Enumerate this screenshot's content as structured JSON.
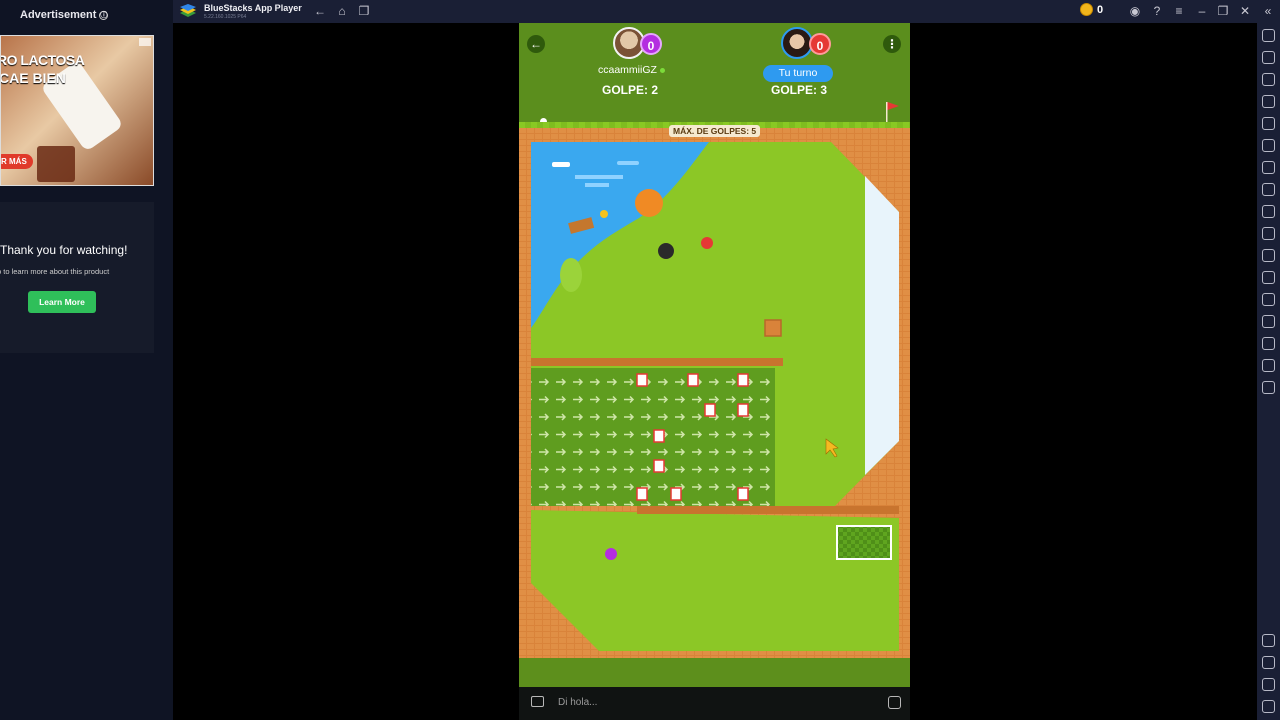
{
  "advertisement": {
    "header": "Advertisement",
    "info_icon": "ⓘ",
    "image_line1": "RO LACTOSA",
    "image_line2": "CAE BIEN",
    "image_cta": "R MÁS",
    "card_title": "Thank you for watching!",
    "card_subtitle": "p to learn more about this product",
    "learn_more_label": "Learn More"
  },
  "window": {
    "app_title": "BlueStacks App Player",
    "version": "5.22.160.1025 P64",
    "coin_count": "0"
  },
  "game": {
    "player1": {
      "name": "ccaammiiGZ",
      "score": "0",
      "strokes_label": "GOLPE: 2"
    },
    "player2": {
      "score": "0",
      "turn_label": "Tu turno",
      "strokes_label": "GOLPE: 3"
    },
    "max_strokes_label": "MÁX. DE GOLPES: 5",
    "chat_placeholder": "Di hola..."
  },
  "colors": {
    "grass": "#8cc726",
    "water": "#3aa8ef",
    "wall": "#d9833a",
    "accent_blue": "#2e9af0",
    "player1_badge": "#b42ee0",
    "player2_badge": "#e53935"
  }
}
